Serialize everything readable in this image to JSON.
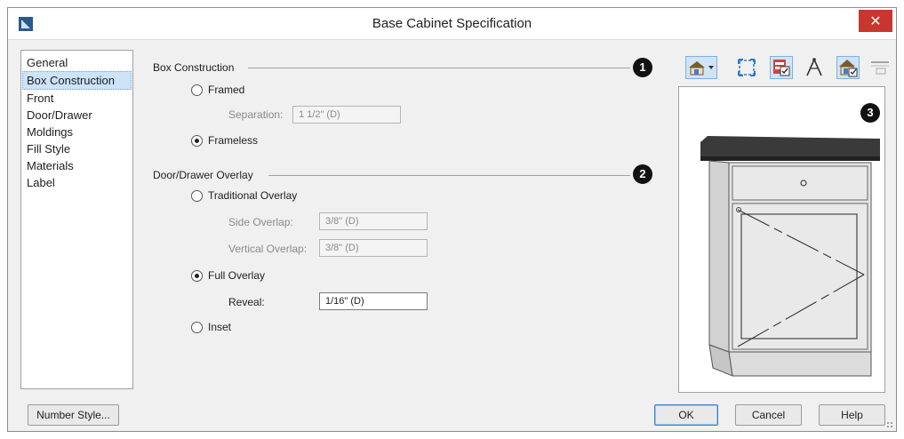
{
  "window": {
    "title": "Base Cabinet Specification",
    "close_glyph": "✕"
  },
  "nav": {
    "items": [
      {
        "label": "General"
      },
      {
        "label": "Box Construction"
      },
      {
        "label": "Front"
      },
      {
        "label": "Door/Drawer"
      },
      {
        "label": "Moldings"
      },
      {
        "label": "Fill Style"
      },
      {
        "label": "Materials"
      },
      {
        "label": "Label"
      }
    ],
    "selected": "Box Construction"
  },
  "box_construction": {
    "title": "Box Construction",
    "callout": "1",
    "framed_label": "Framed",
    "separation_label": "Separation:",
    "separation_value": "1 1/2\" (D)",
    "frameless_label": "Frameless",
    "selected": "Frameless"
  },
  "overlay": {
    "title": "Door/Drawer Overlay",
    "callout": "2",
    "traditional_label": "Traditional Overlay",
    "side_overlap_label": "Side Overlap:",
    "side_overlap_value": "3/8\" (D)",
    "vertical_overlap_label": "Vertical Overlap:",
    "vertical_overlap_value": "3/8\" (D)",
    "full_label": "Full Overlay",
    "reveal_label": "Reveal:",
    "reveal_value": "1/16\" (D)",
    "inset_label": "Inset",
    "selected": "Full Overlay"
  },
  "preview": {
    "callout": "3"
  },
  "toolbar": {
    "icons": [
      "view-mode-icon",
      "fit-view-icon",
      "show-materials-icon",
      "measure-icon",
      "rendered-view-icon",
      "dimension-icon"
    ]
  },
  "buttons": {
    "number_style": "Number Style...",
    "ok": "OK",
    "cancel": "Cancel",
    "help": "Help"
  },
  "colors": {
    "accent_selection": "#cde3f7",
    "close_button": "#c7372f",
    "countertop": "#3a3a3a"
  }
}
